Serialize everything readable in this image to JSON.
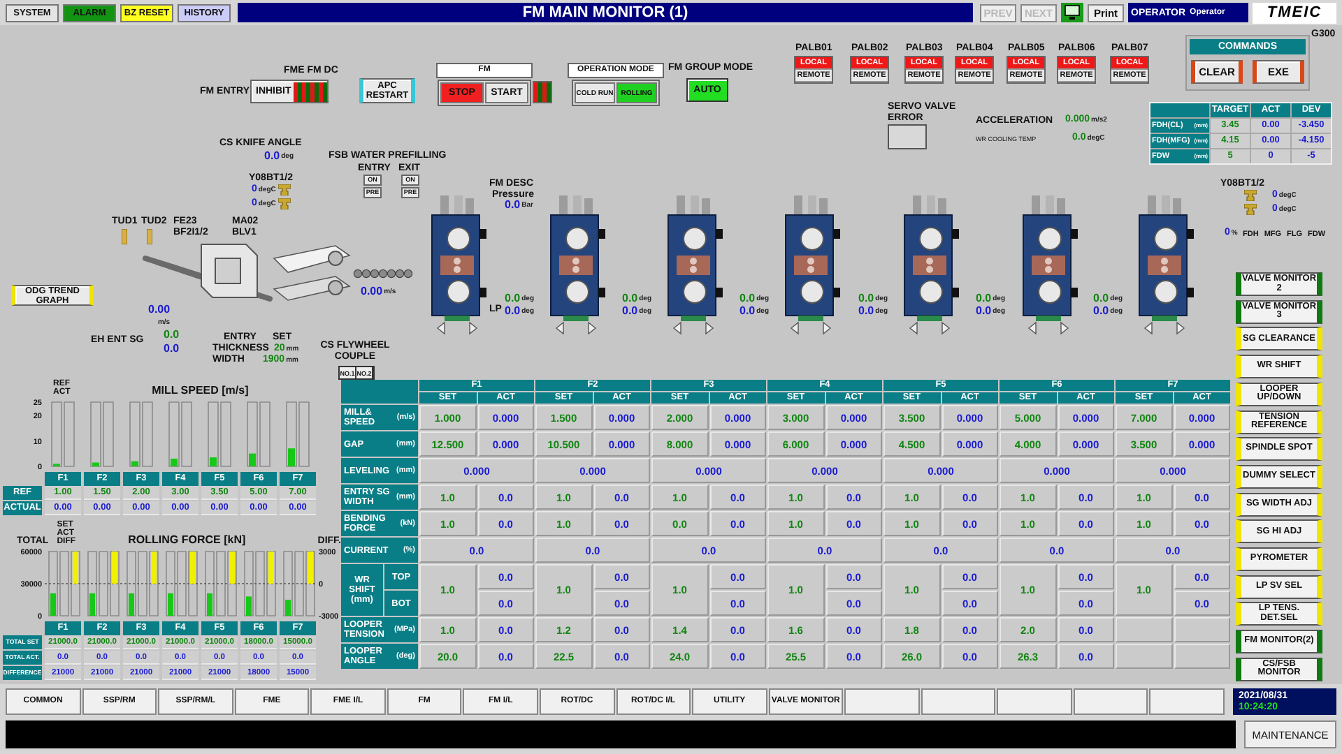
{
  "header": {
    "buttons": [
      {
        "label": "SYSTEM",
        "color": "#e4e4e4"
      },
      {
        "label": "ALARM",
        "color": "#129412"
      },
      {
        "label": "BZ RESET",
        "color": "#ffff20"
      },
      {
        "label": "HISTORY",
        "color": "#ccccf8"
      }
    ],
    "title": "FM MAIN MONITOR (1)",
    "nav": [
      {
        "label": "PREV",
        "disabled": true
      },
      {
        "label": "NEXT",
        "disabled": true
      }
    ],
    "print": "Print",
    "operator": {
      "label": "OPERATOR",
      "value": "Operator"
    },
    "logo": "TMEIC"
  },
  "controls": {
    "fm_entry": {
      "group_label": "FME FM DC",
      "label": "FM ENTRY",
      "button": "INHIBIT"
    },
    "apc_restart": "APC RESTART",
    "fm": {
      "title": "FM",
      "buttons": [
        {
          "label": "STOP",
          "selected": true
        },
        {
          "label": "START",
          "selected": false
        }
      ]
    },
    "operation_mode": {
      "title": "OPERATION MODE",
      "buttons": [
        {
          "label": "COLD RUN",
          "selected": false
        },
        {
          "label": "ROLLING",
          "selected": true
        }
      ]
    },
    "group_mode": {
      "label": "FM GROUP MODE",
      "value": "AUTO"
    },
    "palb": [
      {
        "name": "PALB01",
        "options": [
          {
            "label": "LOCAL",
            "selected": true
          },
          {
            "label": "REMOTE",
            "selected": false
          }
        ]
      },
      {
        "name": "PALB02",
        "options": [
          {
            "label": "LOCAL",
            "selected": true
          },
          {
            "label": "REMOTE",
            "selected": false
          }
        ]
      },
      {
        "name": "PALB03",
        "options": [
          {
            "label": "LOCAL",
            "selected": true
          },
          {
            "label": "REMOTE",
            "selected": false
          }
        ]
      },
      {
        "name": "PALB04",
        "options": [
          {
            "label": "LOCAL",
            "selected": true
          },
          {
            "label": "REMOTE",
            "selected": false
          }
        ]
      },
      {
        "name": "PALB05",
        "options": [
          {
            "label": "LOCAL",
            "selected": true
          },
          {
            "label": "REMOTE",
            "selected": false
          }
        ]
      },
      {
        "name": "PALB06",
        "options": [
          {
            "label": "LOCAL",
            "selected": true
          },
          {
            "label": "REMOTE",
            "selected": false
          }
        ]
      },
      {
        "name": "PALB07",
        "options": [
          {
            "label": "LOCAL",
            "selected": true
          },
          {
            "label": "REMOTE",
            "selected": false
          }
        ]
      }
    ],
    "servo_valve_error": {
      "label": "SERVO VALVE ERROR"
    },
    "acceleration": {
      "label": "ACCELERATION",
      "value": "0.000",
      "unit": "m/s2"
    },
    "wr_cooling_temp": {
      "label": "WR COOLING TEMP",
      "value": "0.0",
      "unit": "degC"
    },
    "screen_id": "G300",
    "commands": {
      "title": "COMMANDS",
      "buttons": [
        "CLEAR",
        "EXE"
      ]
    },
    "fdh_table": {
      "columns": [
        "TARGET",
        "ACT",
        "DEV"
      ],
      "rows": [
        {
          "label": "FDH(CL)",
          "unit": "(mm)",
          "values": [
            "3.45",
            "0.00",
            "-3.450"
          ]
        },
        {
          "label": "FDH(MFG)",
          "unit": "(mm)",
          "values": [
            "4.15",
            "0.00",
            "-4.150"
          ]
        },
        {
          "label": "FDW",
          "unit": "(mm)",
          "values": [
            "5",
            "0",
            "-5"
          ]
        }
      ]
    }
  },
  "mill_line": {
    "cs_knife_angle": {
      "label": "CS KNIFE ANGLE",
      "value": "0.0",
      "unit": "deg"
    },
    "fsb_water_prefilling": {
      "label": "FSB WATER PREFILLING",
      "columns": [
        {
          "label": "ENTRY",
          "buttons": [
            "ON",
            "PRE"
          ]
        },
        {
          "label": "EXIT",
          "buttons": [
            "ON",
            "PRE"
          ]
        }
      ]
    },
    "entry_temps": {
      "label": "Y08BT1/2",
      "readings": [
        {
          "value": "0",
          "unit": "degC"
        },
        {
          "value": "0",
          "unit": "degC"
        }
      ]
    },
    "fm_desc": {
      "label": "FM DESC",
      "sublabel": "Pressure",
      "value": "0.0",
      "unit": "Bar"
    },
    "sensors": [
      "TUD1",
      "TUD2",
      "FE23 BF2I1/2",
      "MA02 BLV1"
    ],
    "odg_button": "ODG TREND GRAPH",
    "entry_speed": {
      "value": "0.00",
      "unit": "m/s"
    },
    "roller_speed": {
      "value": "0.00",
      "unit": "m/s"
    },
    "eh_ent_sg": {
      "label": "EH ENT SG",
      "set": "0.0",
      "act": "0.0"
    },
    "entry_size": {
      "labels": [
        "ENTRY",
        "THICKNESS",
        "WIDTH"
      ],
      "set_label": "SET",
      "thickness": {
        "value": "20",
        "unit": "mm"
      },
      "width": {
        "value": "1900",
        "unit": "mm"
      }
    },
    "cs_flywheel": {
      "label": "CS FLYWHEEL COUPLE",
      "buttons": [
        "NO.1",
        "NO.2"
      ]
    },
    "lp_label": "LP",
    "interstand_angles": [
      {
        "set": "0.0",
        "set_unit": "deg",
        "act": "0.0",
        "act_unit": "deg"
      },
      {
        "set": "0.0",
        "set_unit": "deg",
        "act": "0.0",
        "act_unit": "deg"
      },
      {
        "set": "0.0",
        "set_unit": "deg",
        "act": "0.0",
        "act_unit": "deg"
      },
      {
        "set": "0.0",
        "set_unit": "deg",
        "act": "0.0",
        "act_unit": "deg"
      },
      {
        "set": "0.0",
        "set_unit": "deg",
        "act": "0.0",
        "act_unit": "deg"
      },
      {
        "set": "0.0",
        "set_unit": "deg",
        "act": "0.0",
        "act_unit": "deg"
      }
    ],
    "exit_temps": {
      "label": "Y08BT1/2",
      "readings": [
        {
          "value": "0",
          "unit": "degC"
        },
        {
          "value": "0",
          "unit": "degC"
        }
      ]
    },
    "exit_gauge": {
      "value": "0",
      "unit": "%",
      "labels": [
        "FDH",
        "MFG",
        "FLG",
        "FDW"
      ]
    }
  },
  "mill_speed": {
    "chart_data": {
      "type": "bar",
      "title": "MILL SPEED [m/s]",
      "categories": [
        "F1",
        "F2",
        "F3",
        "F4",
        "F5",
        "F6",
        "F7"
      ],
      "ylim": [
        0,
        25
      ],
      "yticks": [
        0,
        10,
        20,
        25
      ],
      "series": [
        {
          "name": "REF",
          "color": "#18c818",
          "values": [
            1.0,
            1.5,
            2.0,
            3.0,
            3.5,
            5.0,
            7.0
          ]
        },
        {
          "name": "ACT",
          "values": [
            0,
            0,
            0,
            0,
            0,
            0,
            0
          ]
        }
      ]
    },
    "rows": [
      {
        "label": "REF",
        "values": [
          "1.00",
          "1.50",
          "2.00",
          "3.00",
          "3.50",
          "5.00",
          "7.00"
        ]
      },
      {
        "label": "ACTUAL",
        "values": [
          "0.00",
          "0.00",
          "0.00",
          "0.00",
          "0.00",
          "0.00",
          "0.00"
        ]
      }
    ]
  },
  "rolling_force": {
    "axis_label": "TOTAL",
    "diff_label": "DIFF.",
    "diff_legend": "DIFF",
    "diff_ticks": [
      "3000",
      "0",
      "-3000"
    ],
    "chart_data": {
      "type": "bar",
      "title": "ROLLING FORCE [kN]",
      "categories": [
        "F1",
        "F2",
        "F3",
        "F4",
        "F5",
        "F6",
        "F7"
      ],
      "ylim": [
        0,
        60000
      ],
      "yticks": [
        0,
        30000,
        60000
      ],
      "series": [
        {
          "name": "SET",
          "color": "#18c818",
          "values": [
            21000,
            21000,
            21000,
            21000,
            21000,
            18000,
            15000
          ]
        },
        {
          "name": "ACT",
          "values": [
            0,
            0,
            0,
            0,
            0,
            0,
            0
          ]
        }
      ]
    },
    "rows": [
      {
        "label": "TOTAL SET",
        "values": [
          "21000.0",
          "21000.0",
          "21000.0",
          "21000.0",
          "21000.0",
          "18000.0",
          "15000.0"
        ]
      },
      {
        "label": "TOTAL ACT.",
        "values": [
          "0.0",
          "0.0",
          "0.0",
          "0.0",
          "0.0",
          "0.0",
          "0.0"
        ]
      },
      {
        "label": "DIFFERENCE",
        "values": [
          "21000",
          "21000",
          "21000",
          "21000",
          "21000",
          "18000",
          "15000"
        ]
      }
    ]
  },
  "stand_table": {
    "stands": [
      {
        "label": "F1",
        "sub_columns": [
          "SET",
          "ACT"
        ]
      },
      {
        "label": "F2",
        "sub_columns": [
          "SET",
          "ACT"
        ]
      },
      {
        "label": "F3",
        "sub_columns": [
          "SET",
          "ACT"
        ]
      },
      {
        "label": "F4",
        "sub_columns": [
          "SET",
          "ACT"
        ]
      },
      {
        "label": "F5",
        "sub_columns": [
          "SET",
          "ACT"
        ]
      },
      {
        "label": "F6",
        "sub_columns": [
          "SET",
          "ACT"
        ]
      },
      {
        "label": "F7",
        "sub_columns": [
          "SET",
          "ACT"
        ]
      }
    ],
    "rows": [
      {
        "kind": "pair",
        "label": "MILL& SPEED",
        "unit": "(m/s)",
        "cells": [
          [
            "1.000",
            "0.000"
          ],
          [
            "1.500",
            "0.000"
          ],
          [
            "2.000",
            "0.000"
          ],
          [
            "3.000",
            "0.000"
          ],
          [
            "3.500",
            "0.000"
          ],
          [
            "5.000",
            "0.000"
          ],
          [
            "7.000",
            "0.000"
          ]
        ]
      },
      {
        "kind": "pair",
        "label": "GAP",
        "unit": "(mm)",
        "cells": [
          [
            "12.500",
            "0.000"
          ],
          [
            "10.500",
            "0.000"
          ],
          [
            "8.000",
            "0.000"
          ],
          [
            "6.000",
            "0.000"
          ],
          [
            "4.500",
            "0.000"
          ],
          [
            "4.000",
            "0.000"
          ],
          [
            "3.500",
            "0.000"
          ]
        ]
      },
      {
        "kind": "single",
        "label": "LEVELING",
        "unit": "(mm)",
        "cells": [
          "0.000",
          "0.000",
          "0.000",
          "0.000",
          "0.000",
          "0.000",
          "0.000"
        ]
      },
      {
        "kind": "pair",
        "label": "ENTRY SG WIDTH",
        "unit": "(mm)",
        "cells": [
          [
            "1.0",
            "0.0"
          ],
          [
            "1.0",
            "0.0"
          ],
          [
            "1.0",
            "0.0"
          ],
          [
            "1.0",
            "0.0"
          ],
          [
            "1.0",
            "0.0"
          ],
          [
            "1.0",
            "0.0"
          ],
          [
            "1.0",
            "0.0"
          ]
        ]
      },
      {
        "kind": "pair",
        "label": "BENDING FORCE",
        "unit": "(kN)",
        "cells": [
          [
            "1.0",
            "0.0"
          ],
          [
            "1.0",
            "0.0"
          ],
          [
            "0.0",
            "0.0"
          ],
          [
            "1.0",
            "0.0"
          ],
          [
            "1.0",
            "0.0"
          ],
          [
            "1.0",
            "0.0"
          ],
          [
            "1.0",
            "0.0"
          ]
        ]
      },
      {
        "kind": "single",
        "label": "CURRENT",
        "unit": "(%)",
        "cells": [
          "0.0",
          "0.0",
          "0.0",
          "0.0",
          "0.0",
          "0.0",
          "0.0"
        ]
      },
      {
        "kind": "shift",
        "label": "WR SHIFT (mm)",
        "sub_labels": [
          "TOP",
          "BOT"
        ],
        "cells": [
          [
            "1.0",
            "0.0",
            "0.0"
          ],
          [
            "1.0",
            "0.0",
            "0.0"
          ],
          [
            "1.0",
            "0.0",
            "0.0"
          ],
          [
            "1.0",
            "0.0",
            "0.0"
          ],
          [
            "1.0",
            "0.0",
            "0.0"
          ],
          [
            "1.0",
            "0.0",
            "0.0"
          ],
          [
            "1.0",
            "0.0",
            "0.0"
          ]
        ]
      },
      {
        "kind": "pair",
        "label": "LOOPER TENSION",
        "unit": "(MPa)",
        "cells": [
          [
            "1.0",
            "0.0"
          ],
          [
            "1.2",
            "0.0"
          ],
          [
            "1.4",
            "0.0"
          ],
          [
            "1.6",
            "0.0"
          ],
          [
            "1.8",
            "0.0"
          ],
          [
            "2.0",
            "0.0"
          ]
        ]
      },
      {
        "kind": "pair",
        "label": "LOOPER ANGLE",
        "unit": "(deg)",
        "cells": [
          [
            "20.0",
            "0.0"
          ],
          [
            "22.5",
            "0.0"
          ],
          [
            "24.0",
            "0.0"
          ],
          [
            "25.5",
            "0.0"
          ],
          [
            "26.0",
            "0.0"
          ],
          [
            "26.3",
            "0.0"
          ]
        ]
      }
    ]
  },
  "side_buttons": [
    {
      "label": "VALVE MONITOR 2",
      "color": "#107a10"
    },
    {
      "label": "VALVE MONITOR 3",
      "color": "#107a10"
    },
    {
      "label": "SG CLEARANCE",
      "color": "#f0e400"
    },
    {
      "label": "WR SHIFT",
      "color": "#f0e400"
    },
    {
      "label": "LOOPER UP/DOWN",
      "color": "#f0e400"
    },
    {
      "label": "TENSION REFERENCE",
      "color": "#f0e400"
    },
    {
      "label": "SPINDLE SPOT",
      "color": "#f0e400"
    },
    {
      "label": "DUMMY SELECT",
      "color": "#f0e400"
    },
    {
      "label": "SG WIDTH ADJ",
      "color": "#f0e400"
    },
    {
      "label": "SG HI ADJ",
      "color": "#f0e400"
    },
    {
      "label": "PYROMETER",
      "color": "#f0e400"
    },
    {
      "label": "LP SV SEL",
      "color": "#f0e400"
    },
    {
      "label": "LP TENS. DET.SEL",
      "color": "#f0e400"
    },
    {
      "label": "FM MONITOR(2)",
      "color": "#107a10"
    },
    {
      "label": "CS/FSB MONITOR",
      "color": "#107a10"
    }
  ],
  "footer": {
    "tabs": [
      "COMMON",
      "SSP/RM",
      "SSP/RM/L",
      "FME",
      "FME I/L",
      "FM",
      "FM I/L",
      "ROT/DC",
      "ROT/DC I/L",
      "UTILITY",
      "VALVE MONITOR"
    ],
    "date": "2021/08/31",
    "time": "10:24:20",
    "maintenance": "MAINTENANCE"
  }
}
